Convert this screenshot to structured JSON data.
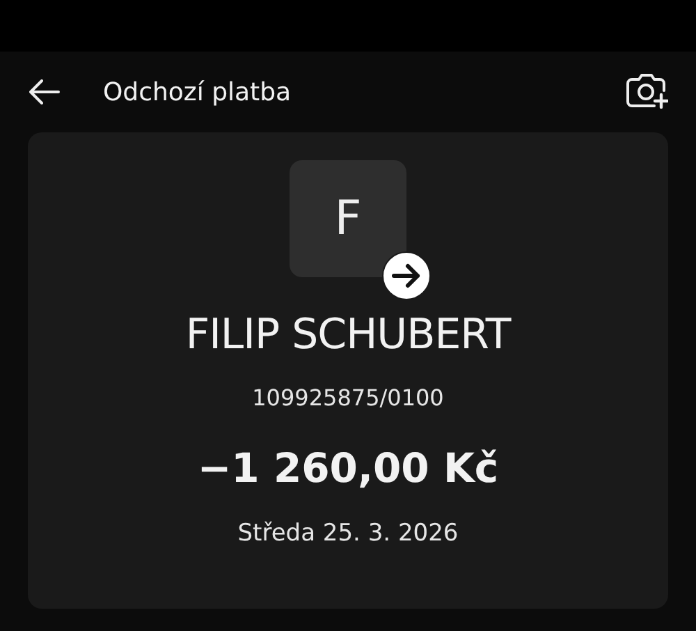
{
  "header": {
    "title": "Odchozí platba"
  },
  "payment": {
    "avatar_initial": "F",
    "name": "FILIP SCHUBERT",
    "account": "109925875/0100",
    "amount": "−1 260,00 Kč",
    "date": "Středa 25. 3. 2026"
  }
}
